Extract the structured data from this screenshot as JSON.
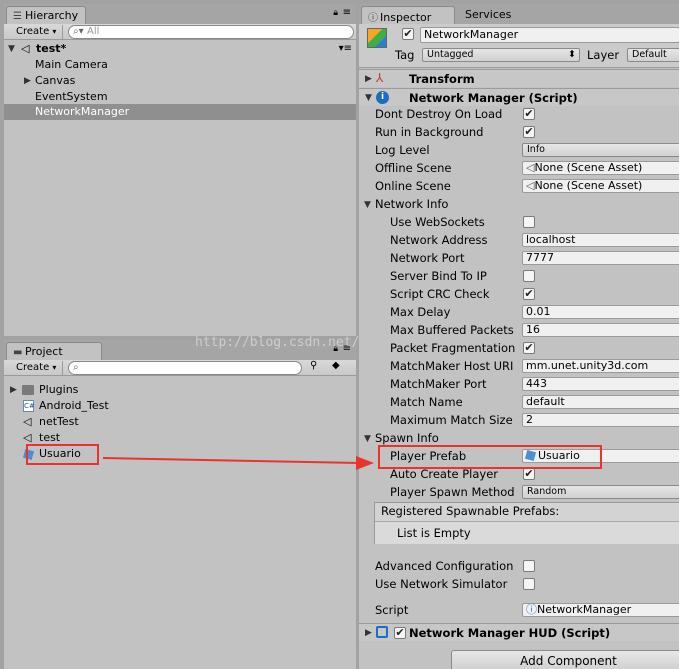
{
  "hierarchy": {
    "tab_label": "Hierarchy",
    "create_label": "Create",
    "search_placeholder": "All",
    "scene_name": "test*",
    "items": [
      "Main Camera",
      "Canvas",
      "EventSystem",
      "NetworkManager"
    ]
  },
  "project": {
    "tab_label": "Project",
    "create_label": "Create",
    "items": [
      "Plugins",
      "Android_Test",
      "netTest",
      "test",
      "Usuario"
    ]
  },
  "inspector": {
    "tab_label": "Inspector",
    "services_tab_label": "Services",
    "object_name": "NetworkManager",
    "tag_label": "Tag",
    "tag_value": "Untagged",
    "layer_label": "Layer",
    "layer_value": "Default",
    "transform_label": "Transform",
    "network_manager_label": "Network Manager (Script)",
    "fields": {
      "dont_destroy": "Dont Destroy On Load",
      "run_in_background": "Run in Background",
      "log_level": "Log Level",
      "log_level_value": "Info",
      "offline_scene": "Offline Scene",
      "offline_scene_value": "None (Scene Asset)",
      "online_scene": "Online Scene",
      "online_scene_value": "None (Scene Asset)",
      "network_info": "Network Info",
      "use_websockets": "Use WebSockets",
      "network_address": "Network Address",
      "network_address_value": "localhost",
      "network_port": "Network Port",
      "network_port_value": "7777",
      "server_bind_to_ip": "Server Bind To IP",
      "script_crc_check": "Script CRC Check",
      "max_delay": "Max Delay",
      "max_delay_value": "0.01",
      "max_buffered_packets": "Max Buffered Packets",
      "max_buffered_packets_value": "16",
      "packet_fragmentation": "Packet Fragmentation",
      "matchmaker_host_uri": "MatchMaker Host URI",
      "matchmaker_host_uri_value": "mm.unet.unity3d.com",
      "matchmaker_port": "MatchMaker Port",
      "matchmaker_port_value": "443",
      "match_name": "Match Name",
      "match_name_value": "default",
      "max_match_size": "Maximum Match Size",
      "max_match_size_value": "2",
      "spawn_info": "Spawn Info",
      "player_prefab": "Player Prefab",
      "player_prefab_value": "Usuario",
      "auto_create_player": "Auto Create Player",
      "player_spawn_method": "Player Spawn Method",
      "player_spawn_method_value": "Random",
      "registered_spawnable": "Registered Spawnable Prefabs:",
      "list_is_empty": "List is Empty",
      "advanced_configuration": "Advanced Configuration",
      "use_network_simulator": "Use Network Simulator",
      "script": "Script",
      "script_value": "NetworkManager"
    },
    "hud_label": "Network Manager HUD (Script)",
    "add_component_label": "Add Component"
  },
  "watermark": "http://blog.csdn.net/",
  "colors": {
    "accent_red": "#e8332f",
    "selection": "#8f8f8f",
    "panel": "#c2c2c2"
  }
}
